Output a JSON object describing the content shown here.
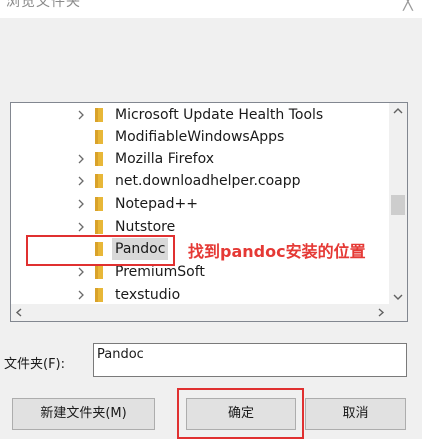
{
  "window": {
    "title": "浏览文件夹",
    "close_glyph": "╳"
  },
  "tree": {
    "items": [
      {
        "label": "Microsoft Update Health Tools",
        "expandable": true,
        "selected": false
      },
      {
        "label": "ModifiableWindowsApps",
        "expandable": false,
        "selected": false
      },
      {
        "label": "Mozilla Firefox",
        "expandable": true,
        "selected": false
      },
      {
        "label": "net.downloadhelper.coapp",
        "expandable": true,
        "selected": false
      },
      {
        "label": "Notepad++",
        "expandable": true,
        "selected": false
      },
      {
        "label": "Nutstore",
        "expandable": true,
        "selected": false
      },
      {
        "label": "Pandoc",
        "expandable": false,
        "selected": true
      },
      {
        "label": "PremiumSoft",
        "expandable": true,
        "selected": false
      },
      {
        "label": "texstudio",
        "expandable": true,
        "selected": false
      }
    ],
    "vertical_scroll_position": 0.55
  },
  "annotation": {
    "text": "找到pandoc安装的位置",
    "color": "#e53935"
  },
  "folder_field": {
    "label": "文件夹(F):",
    "value": "Pandoc"
  },
  "buttons": {
    "new_folder": "新建文件夹(M)",
    "ok": "确定",
    "cancel": "取消"
  },
  "colors": {
    "folder": "#e8b738",
    "selection": "#d9d9d9",
    "annotation_border": "#e03030"
  }
}
